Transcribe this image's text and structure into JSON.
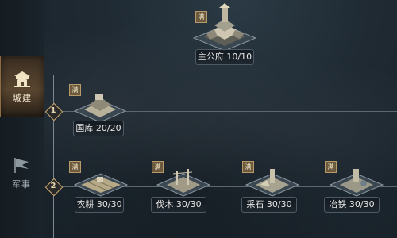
{
  "sidebar": {
    "tabs": [
      {
        "label": "城建",
        "icon": "city-building-icon",
        "active": true
      },
      {
        "label": "军事",
        "icon": "military-flag-icon",
        "active": false
      }
    ]
  },
  "max_badge_text": "满",
  "tiers": [
    {
      "number": "1"
    },
    {
      "number": "2"
    }
  ],
  "buildings": {
    "main": {
      "name": "主公府",
      "level": "10/10"
    },
    "warehouse": {
      "name": "国库",
      "level": "20/20"
    },
    "farm": {
      "name": "农耕",
      "level": "30/30"
    },
    "lumber": {
      "name": "伐木",
      "level": "30/30"
    },
    "quarry": {
      "name": "采石",
      "level": "30/30"
    },
    "smelt": {
      "name": "冶铁",
      "level": "30/30"
    }
  },
  "colors": {
    "accent_gold": "#c9a86b",
    "background": "#1f2a33"
  }
}
